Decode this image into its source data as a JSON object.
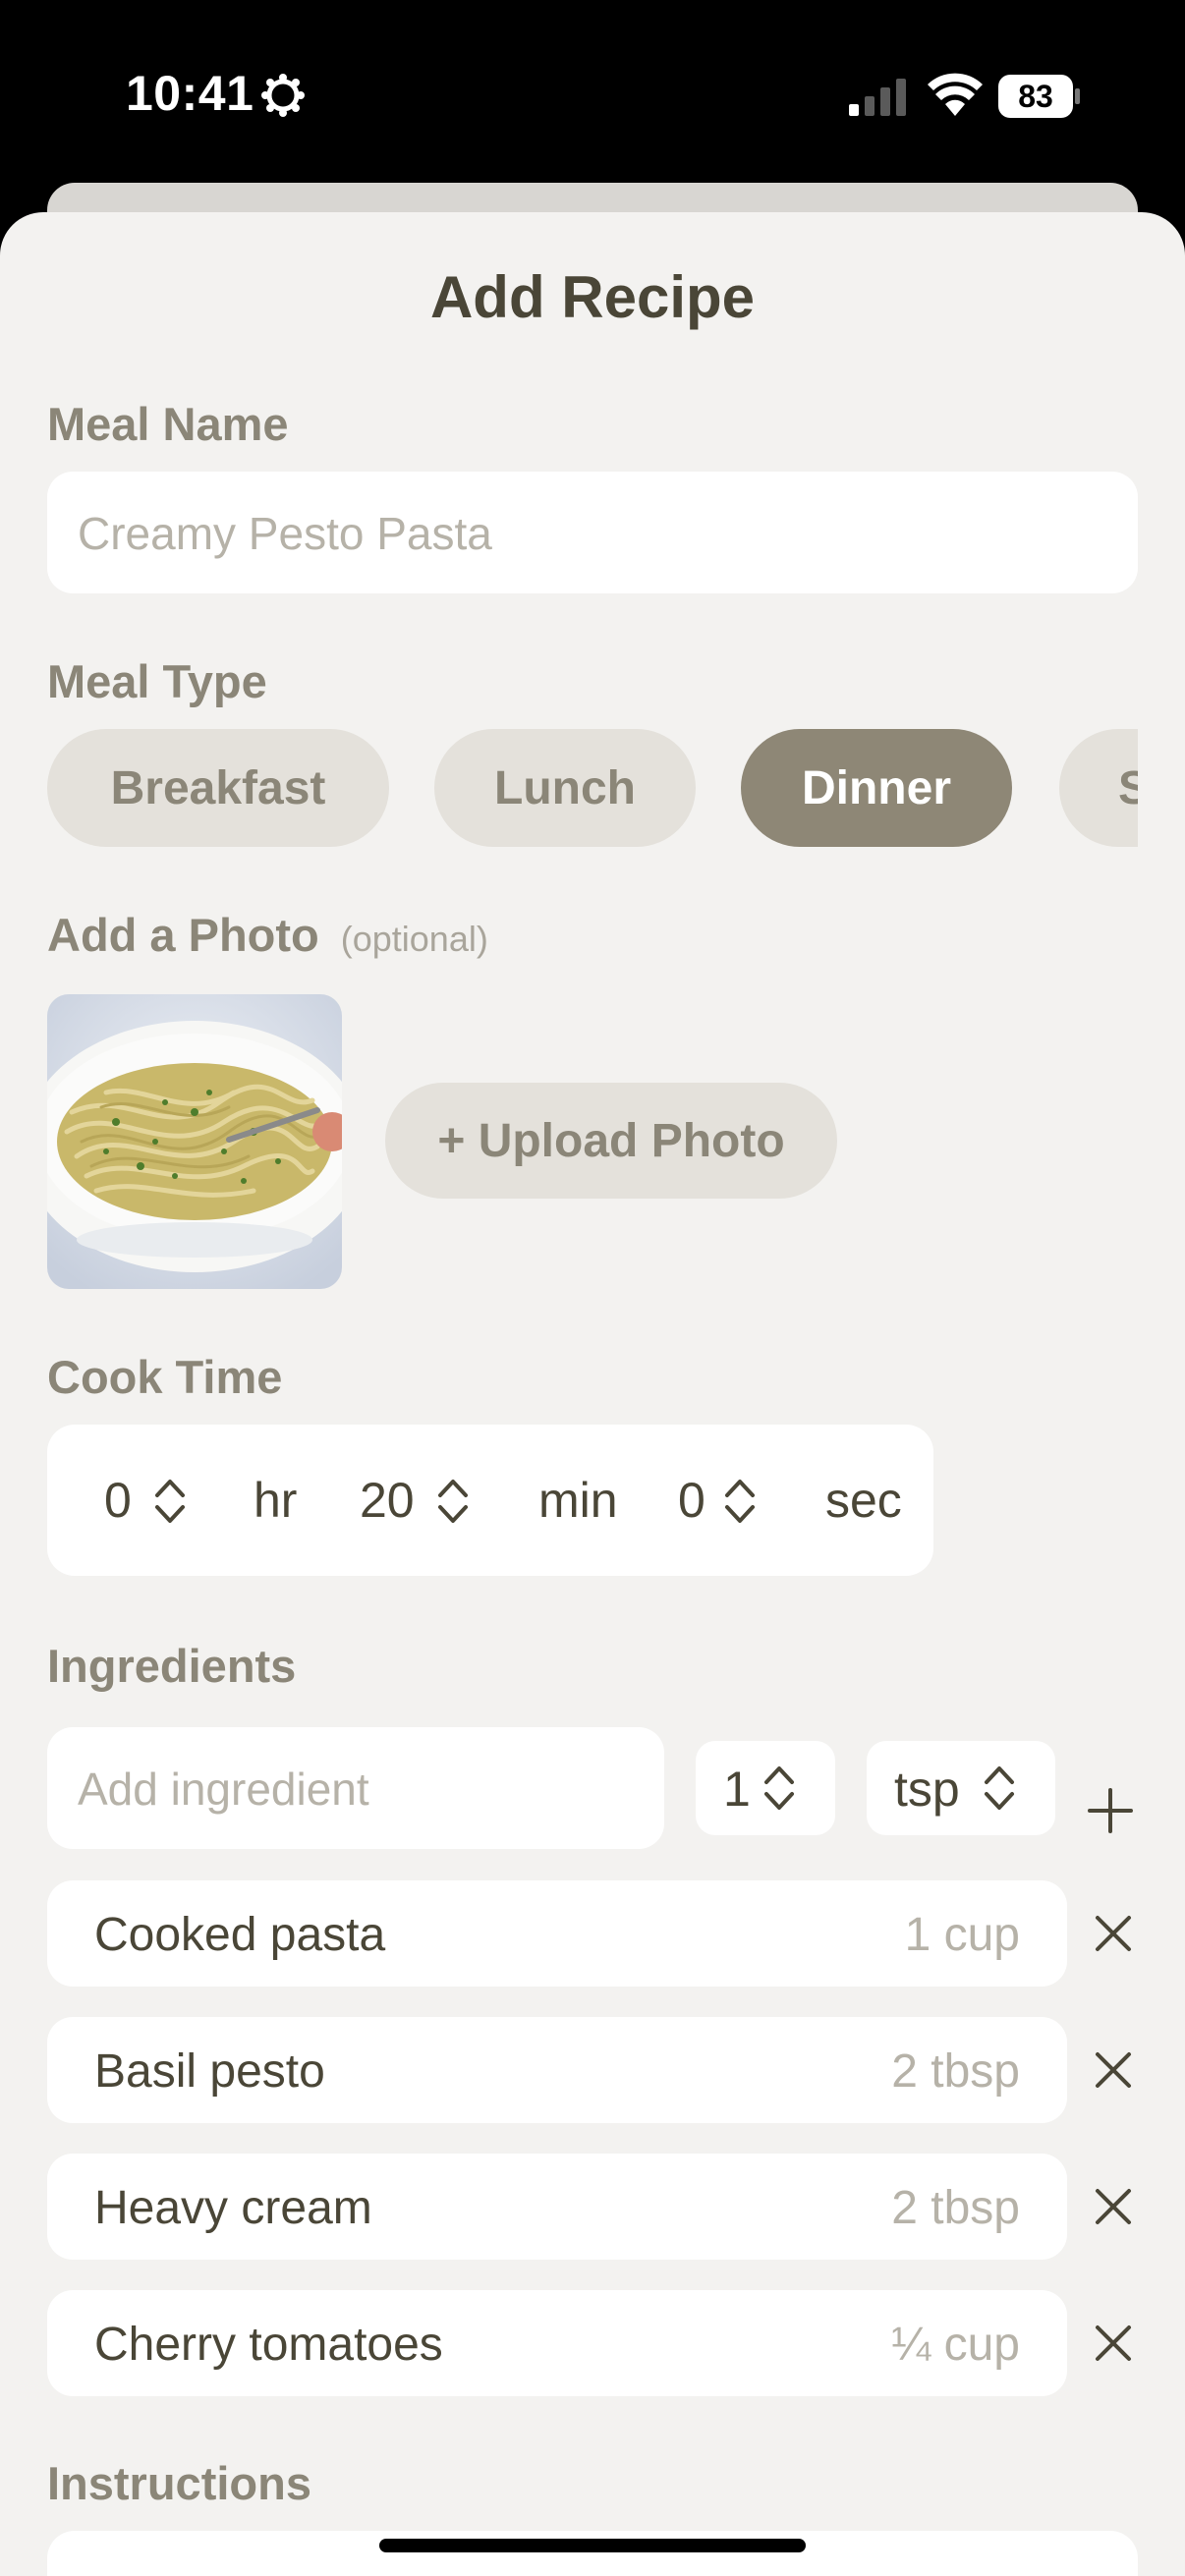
{
  "status_bar": {
    "time": "10:41",
    "battery": "83"
  },
  "title": "Add Recipe",
  "meal_name": {
    "label": "Meal Name",
    "placeholder": "Creamy Pesto Pasta"
  },
  "meal_type": {
    "label": "Meal Type",
    "options": [
      "Breakfast",
      "Lunch",
      "Dinner",
      "S"
    ],
    "selected": "Dinner"
  },
  "photo": {
    "label": "Add a Photo",
    "optional": "(optional)",
    "upload_label": "+ Upload Photo"
  },
  "cook_time": {
    "label": "Cook Time",
    "hours": "0",
    "hours_unit": "hr",
    "minutes": "20",
    "minutes_unit": "min",
    "seconds": "0",
    "seconds_unit": "sec"
  },
  "ingredients": {
    "label": "Ingredients",
    "add_placeholder": "Add ingredient",
    "quantity": "1",
    "unit": "tsp",
    "items": [
      {
        "name": "Cooked pasta",
        "qty": "1 cup"
      },
      {
        "name": "Basil pesto",
        "qty": "2 tbsp"
      },
      {
        "name": "Heavy cream",
        "qty": "2 tbsp"
      },
      {
        "name": "Cherry tomatoes",
        "qty": "¼ cup"
      }
    ]
  },
  "instructions": {
    "label": "Instructions"
  },
  "colors": {
    "accent": "#8e8776",
    "text": "#4a4637",
    "label": "#8b8678",
    "background": "#f3f2f0"
  }
}
